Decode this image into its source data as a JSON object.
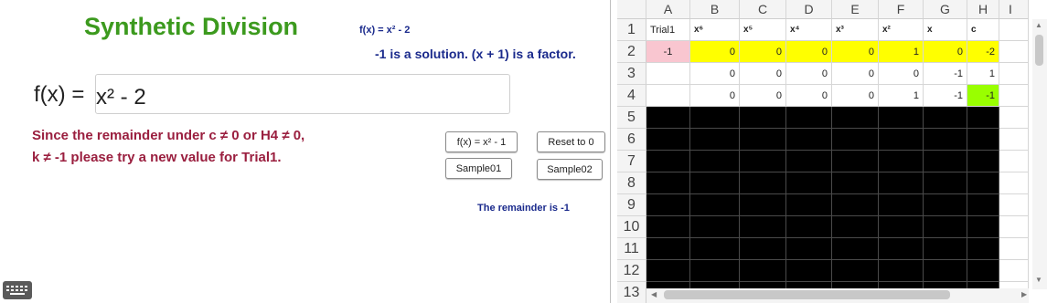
{
  "title": "Synthetic Division",
  "fx_small": "f(x) = x² - 2",
  "solution_text": "-1 is a solution. (x + 1) is a factor.",
  "fx_label": "f(x) =",
  "fx_input_value": "x² - 2",
  "message_line1": "Since the remainder under c ≠ 0 or H4 ≠ 0,",
  "message_line2": "k ≠ -1 please try a new value for Trial1.",
  "buttons": {
    "fx_preset": "f(x) = x² - 1",
    "reset": "Reset to 0",
    "sample01": "Sample01",
    "sample02": "Sample02"
  },
  "remainder_text": "The remainder is -1",
  "spreadsheet": {
    "columns": [
      "A",
      "B",
      "C",
      "D",
      "E",
      "F",
      "G",
      "H",
      "I"
    ],
    "rows": [
      "1",
      "2",
      "3",
      "4",
      "5",
      "6",
      "7",
      "8",
      "9",
      "10",
      "11",
      "12",
      "13"
    ],
    "row1": [
      "Trial1",
      "x⁶",
      "x⁵",
      "x⁴",
      "x³",
      "x²",
      "x",
      "c"
    ],
    "row2": [
      "-1",
      "0",
      "0",
      "0",
      "0",
      "1",
      "0",
      "-2"
    ],
    "row3": [
      "",
      "0",
      "0",
      "0",
      "0",
      "0",
      "-1",
      "1"
    ],
    "row4": [
      "",
      "0",
      "0",
      "0",
      "0",
      "1",
      "-1",
      "-1"
    ]
  },
  "colors": {
    "title": "#3c9a1e",
    "info_text": "#1a2a8c",
    "warning_text": "#9a1f3f",
    "trial_cell": "#f9c6d0",
    "coef_cells": "#ffff00",
    "remainder_cell": "#99ff00",
    "empty_region": "#000000"
  },
  "icons": {
    "keyboard": "keyboard-icon"
  }
}
